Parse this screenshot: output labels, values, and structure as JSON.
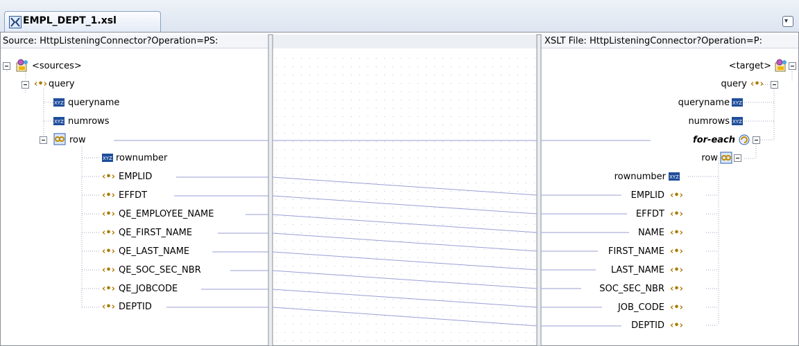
{
  "tab": {
    "label": "EMPL_DEPT_1.xsl"
  },
  "menu_button": {
    "glyph": "▾"
  },
  "source": {
    "title": "Source: HttpListeningConnector?Operation=PS:",
    "root": "<sources>",
    "query": "query",
    "queryname": "queryname",
    "numrows": "numrows",
    "row": "row",
    "rownumber": "rownumber",
    "fields": [
      "EMPLID",
      "EFFDT",
      "QE_EMPLOYEE_NAME",
      "QE_FIRST_NAME",
      "QE_LAST_NAME",
      "QE_SOC_SEC_NBR",
      "QE_JOBCODE",
      "DEPTID"
    ]
  },
  "target": {
    "title": "XSLT File: HttpListeningConnector?Operation=P:",
    "root": "<target>",
    "query": "query",
    "queryname": "queryname",
    "numrows": "numrows",
    "for_each": "for-each",
    "row": "row",
    "rownumber": "rownumber",
    "fields": [
      "EMPLID",
      "EFFDT",
      "NAME",
      "FIRST_NAME",
      "LAST_NAME",
      "SOC_SEC_NBR",
      "JOB_CODE",
      "DEPTID"
    ]
  },
  "colors": {
    "mapping_line": "#9a9ed6",
    "tree_line": "#9aa4b8",
    "panel_border": "#8a8f99"
  }
}
